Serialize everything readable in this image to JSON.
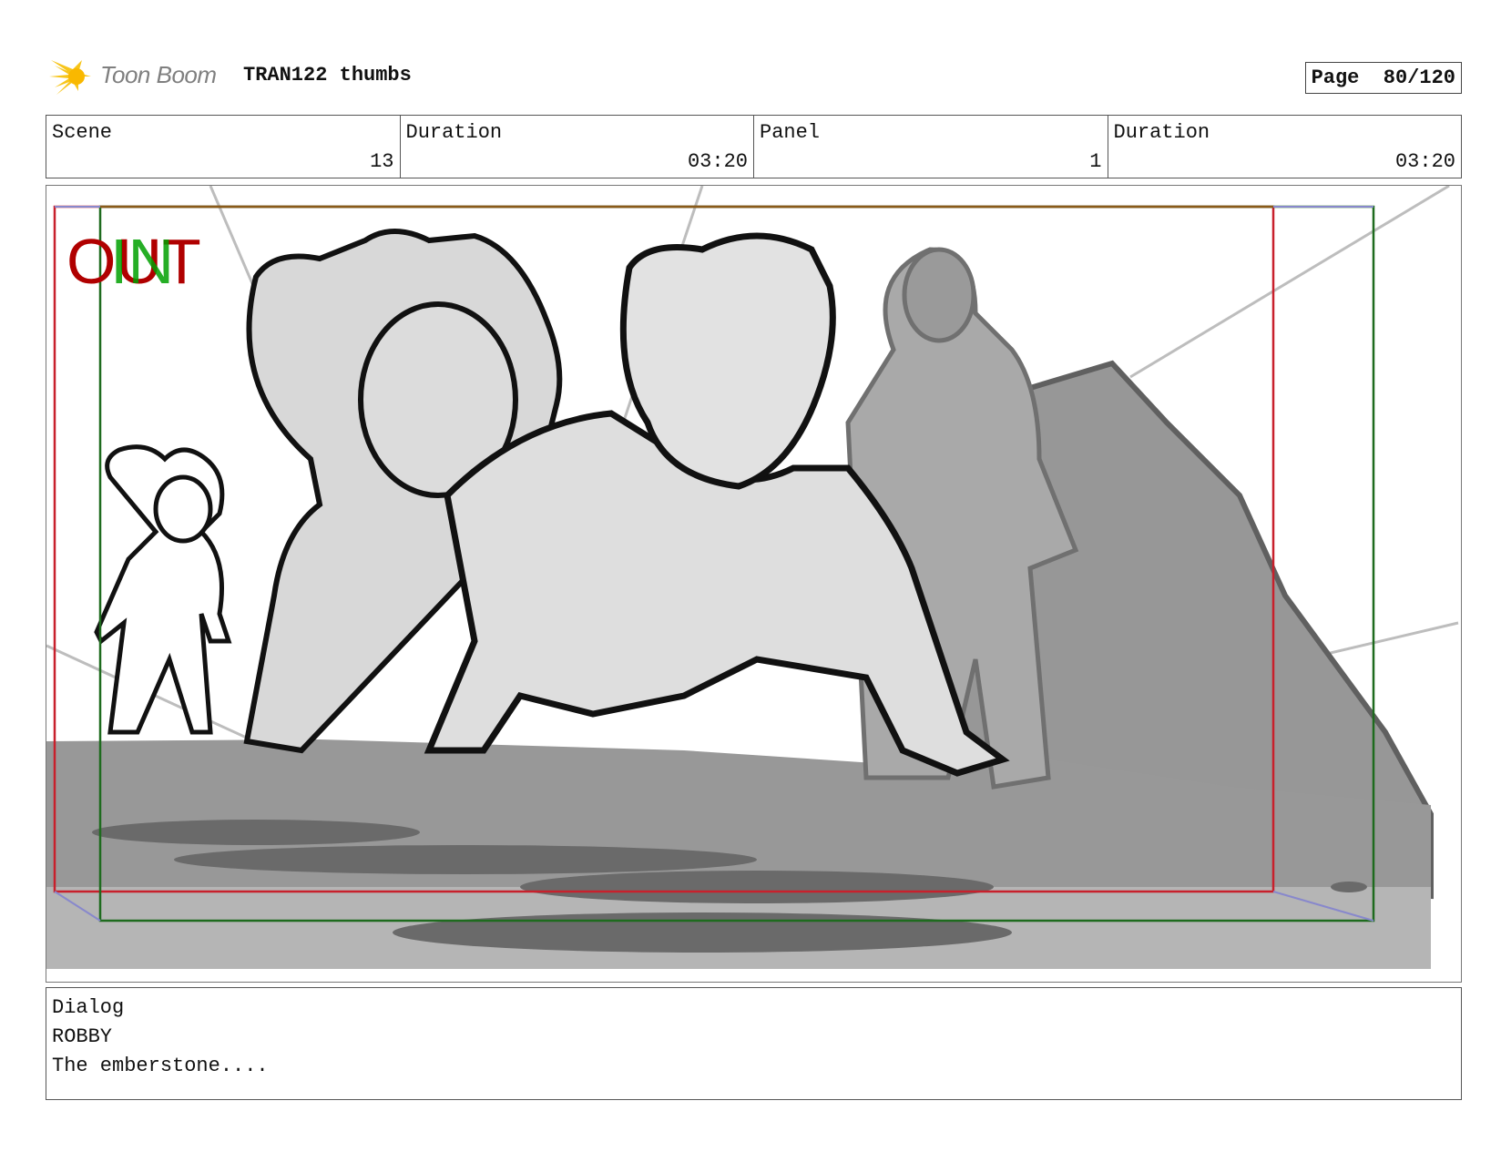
{
  "header": {
    "logo_text": "Toon Boom",
    "title": "TRAN122 thumbs",
    "page": "Page  80/120"
  },
  "info": {
    "scene_label": "Scene",
    "scene_value": "13",
    "duration_label": "Duration",
    "duration_value": "03:20",
    "panel_label": "Panel",
    "panel_value": "1",
    "panel_duration_label": "Duration",
    "panel_duration_value": "03:20"
  },
  "frame": {
    "out_label": "OUT",
    "in_label": "IN",
    "colors": {
      "out": "#b00000",
      "in": "#00a000",
      "frame_red": "#c8202c",
      "frame_green": "#1e6b1e"
    }
  },
  "dialog": {
    "label": "Dialog",
    "speaker": "ROBBY",
    "line": "The emberstone...."
  }
}
